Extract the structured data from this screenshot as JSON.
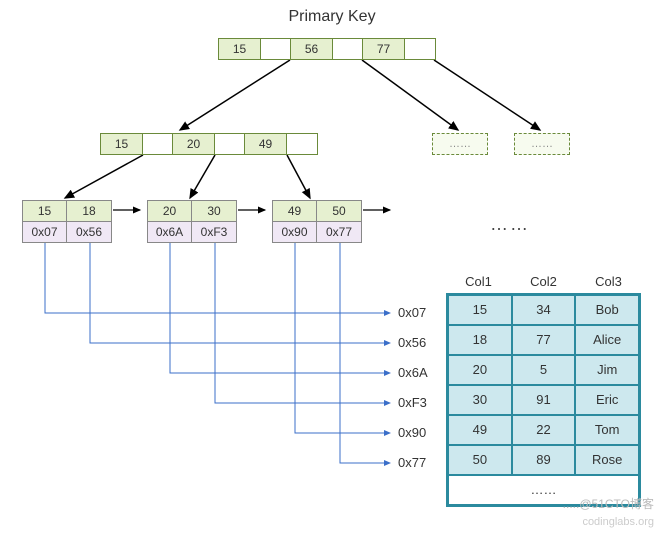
{
  "title": "Primary Key",
  "root": {
    "keys": [
      "15",
      "56",
      "77"
    ]
  },
  "level1": {
    "keys": [
      "15",
      "20",
      "49"
    ]
  },
  "dashed_placeholders": [
    "……",
    "……"
  ],
  "leaves": [
    {
      "keys": [
        "15",
        "18"
      ],
      "ptrs": [
        "0x07",
        "0x56"
      ]
    },
    {
      "keys": [
        "20",
        "30"
      ],
      "ptrs": [
        "0x6A",
        "0xF3"
      ]
    },
    {
      "keys": [
        "49",
        "50"
      ],
      "ptrs": [
        "0x90",
        "0x77"
      ]
    }
  ],
  "leaf_ellipsis": "……",
  "pointer_labels": [
    "0x07",
    "0x56",
    "0x6A",
    "0xF3",
    "0x90",
    "0x77"
  ],
  "table": {
    "headers": [
      "Col1",
      "Col2",
      "Col3"
    ],
    "rows": [
      [
        "15",
        "34",
        "Bob"
      ],
      [
        "18",
        "77",
        "Alice"
      ],
      [
        "20",
        "5",
        "Jim"
      ],
      [
        "30",
        "91",
        "Eric"
      ],
      [
        "49",
        "22",
        "Tom"
      ],
      [
        "50",
        "89",
        "Rose"
      ]
    ],
    "ellipsis_row": "……"
  },
  "watermark1": ".....@51CTO博客",
  "watermark2": "codinglabs.org"
}
